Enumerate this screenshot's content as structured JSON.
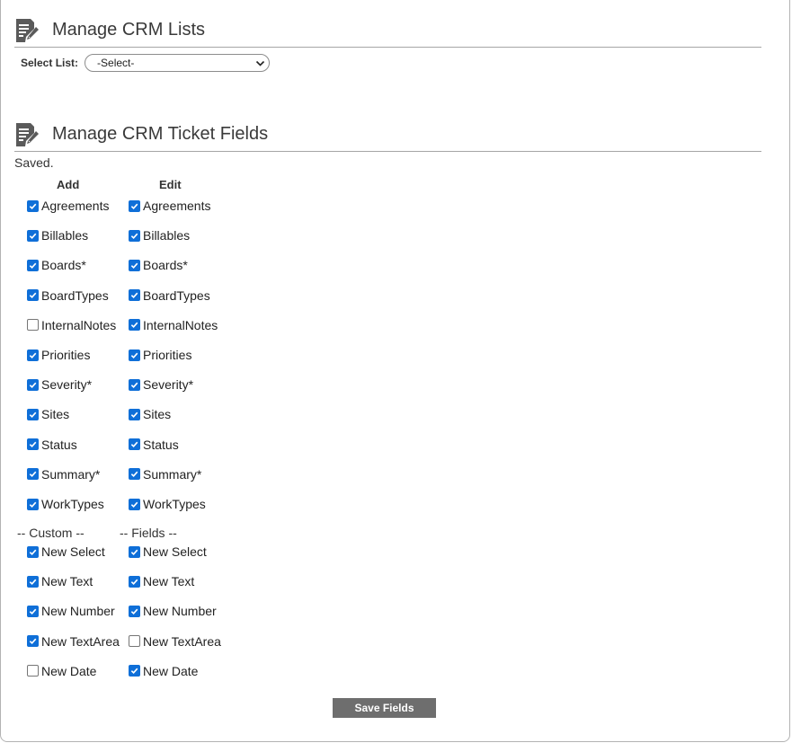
{
  "lists_section": {
    "title": "Manage CRM Lists",
    "icon": "edit-document-icon"
  },
  "select_list": {
    "label": "Select List:",
    "selected": "-Select-"
  },
  "fields_section": {
    "title": "Manage CRM Ticket Fields",
    "icon": "edit-document-icon",
    "status": "Saved."
  },
  "columns": {
    "add": "Add",
    "edit": "Edit"
  },
  "fields": [
    {
      "name": "Agreements",
      "add": true,
      "edit": true
    },
    {
      "name": "Billables",
      "add": true,
      "edit": true
    },
    {
      "name": "Boards*",
      "add": true,
      "edit": true
    },
    {
      "name": "BoardTypes",
      "add": true,
      "edit": true
    },
    {
      "name": "InternalNotes",
      "add": false,
      "edit": true
    },
    {
      "name": "Priorities",
      "add": true,
      "edit": true
    },
    {
      "name": "Severity*",
      "add": true,
      "edit": true
    },
    {
      "name": "Sites",
      "add": true,
      "edit": true
    },
    {
      "name": "Status",
      "add": true,
      "edit": true
    },
    {
      "name": "Summary*",
      "add": true,
      "edit": true
    },
    {
      "name": "WorkTypes",
      "add": true,
      "edit": true
    }
  ],
  "custom_separator": {
    "left": "-- Custom --",
    "right": "-- Fields --"
  },
  "custom_fields": [
    {
      "name": "New Select",
      "add": true,
      "edit": true
    },
    {
      "name": "New Text",
      "add": true,
      "edit": true
    },
    {
      "name": "New Number",
      "add": true,
      "edit": true
    },
    {
      "name": "New TextArea",
      "add": true,
      "edit": false
    },
    {
      "name": "New Date",
      "add": false,
      "edit": true
    }
  ],
  "save_button": {
    "label": "Save Fields"
  },
  "colors": {
    "checkbox_checked": "#0f6fd8",
    "button_bg": "#6e6e6e"
  }
}
